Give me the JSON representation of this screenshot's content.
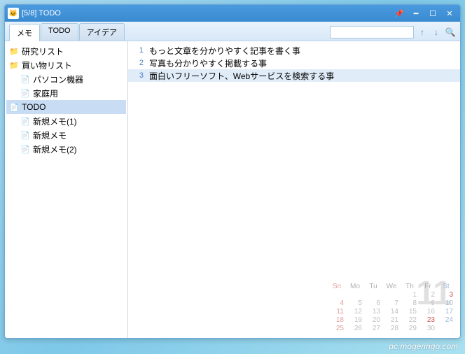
{
  "window": {
    "title": "[5/8] TODO"
  },
  "tabs": [
    {
      "label": "メモ",
      "active": true
    },
    {
      "label": "TODO",
      "active": false
    },
    {
      "label": "アイデア",
      "active": false
    }
  ],
  "search": {
    "value": ""
  },
  "tree": [
    {
      "icon": "folder-yellow",
      "label": "研究リスト",
      "indent": 0
    },
    {
      "icon": "folder-green",
      "label": "買い物リスト",
      "indent": 0
    },
    {
      "icon": "page-white",
      "label": "パソコン機器",
      "indent": 1
    },
    {
      "icon": "page-white",
      "label": "家庭用",
      "indent": 1
    },
    {
      "icon": "page-white",
      "label": "TODO",
      "indent": 0,
      "selected": true
    },
    {
      "icon": "page-green",
      "label": "新規メモ(1)",
      "indent": 1
    },
    {
      "icon": "page-white",
      "label": "新規メモ",
      "indent": 1
    },
    {
      "icon": "page-red",
      "label": "新規メモ(2)",
      "indent": 1
    }
  ],
  "lines": [
    {
      "n": "1",
      "t": "もっと文章を分かりやすく記事を書く事"
    },
    {
      "n": "2",
      "t": "写真も分かりやすく掲載する事"
    },
    {
      "n": "3",
      "t": "面白いフリーソフト、Webサービスを検索する事",
      "selected": true
    }
  ],
  "calendar": {
    "month": "11",
    "headers": [
      "Sn",
      "Mo",
      "Tu",
      "We",
      "Th",
      "Fr",
      "St"
    ],
    "weeks": [
      [
        "",
        "",
        "",
        "",
        "1",
        "2",
        "3"
      ],
      [
        "4",
        "5",
        "6",
        "7",
        "8",
        "9",
        "10"
      ],
      [
        "11",
        "12",
        "13",
        "14",
        "15",
        "16",
        "17"
      ],
      [
        "18",
        "19",
        "20",
        "21",
        "22",
        "23",
        "24"
      ],
      [
        "25",
        "26",
        "27",
        "28",
        "29",
        "30",
        ""
      ]
    ],
    "red_days": [
      "3",
      "23"
    ]
  },
  "watermark": "pc.mogeringo.com"
}
